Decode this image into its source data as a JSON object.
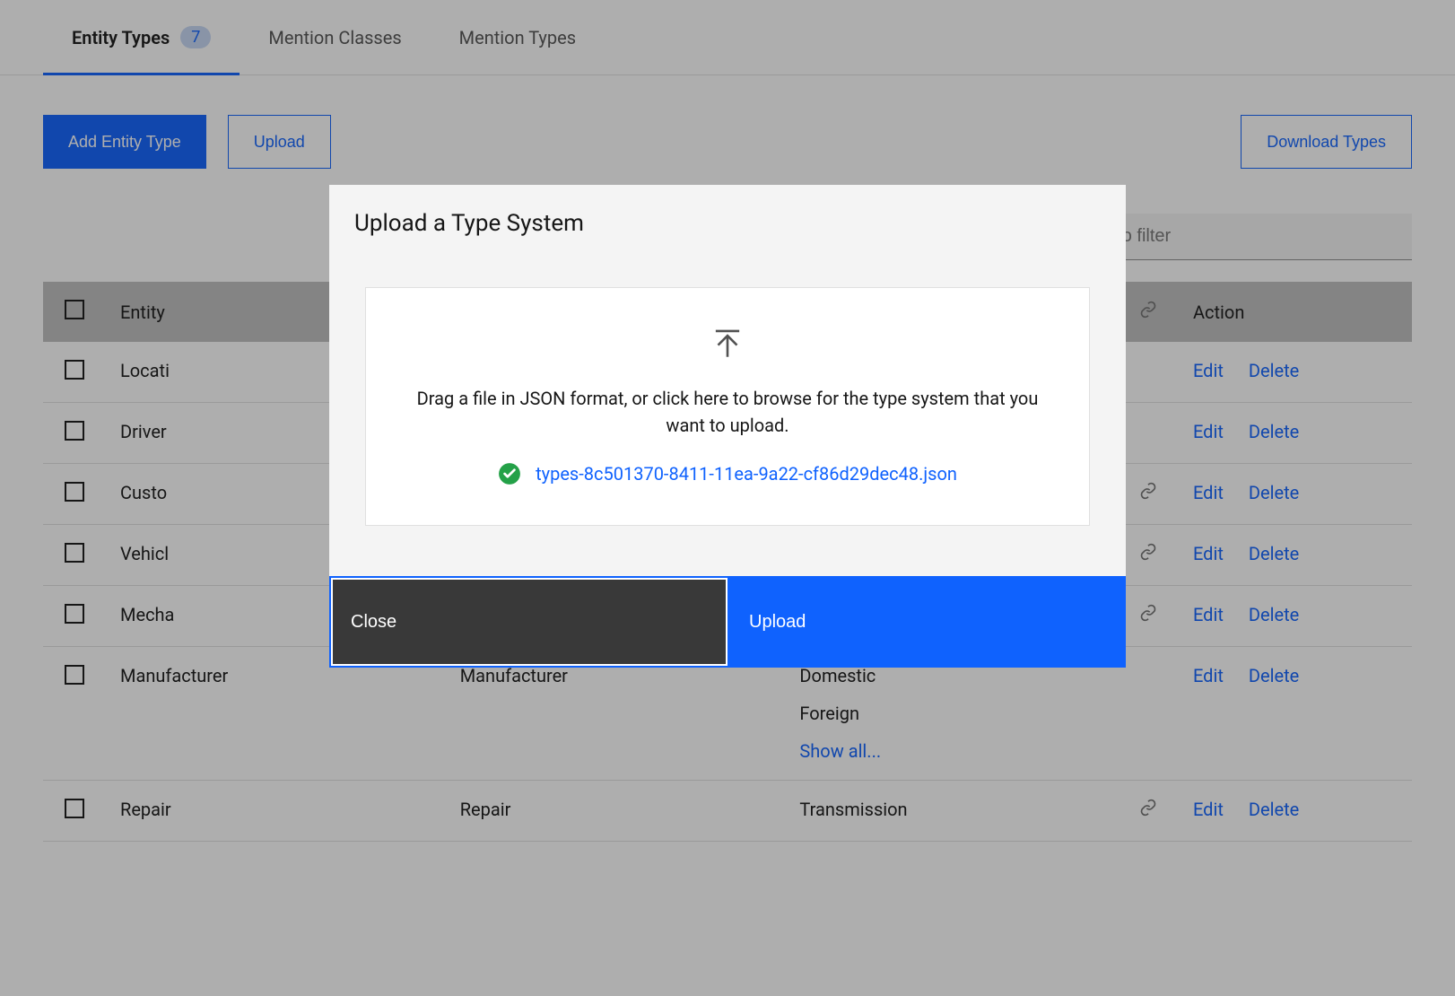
{
  "tabs": {
    "entity_types": "Entity Types",
    "entity_count": "7",
    "mention_classes": "Mention Classes",
    "mention_types": "Mention Types"
  },
  "toolbar": {
    "add": "Add Entity Type",
    "upload": "Upload",
    "download": "Download Types"
  },
  "search": {
    "placeholder": "Enter text to filter"
  },
  "table": {
    "headers": {
      "entity": "Entity",
      "action": "Action"
    },
    "edit": "Edit",
    "delete": "Delete",
    "showall": "Show all...",
    "rows": [
      {
        "entity": "Locati",
        "link": false
      },
      {
        "entity": "Driver",
        "link": false
      },
      {
        "entity": "Custo",
        "link": true
      },
      {
        "entity": "Vehicl",
        "link": true
      },
      {
        "entity": "Mecha",
        "link": true
      }
    ],
    "lower_rows": [
      {
        "entity": "Manufacturer",
        "col2": "Manufacturer",
        "sub": [
          "Domestic",
          "Foreign"
        ],
        "showall": true,
        "link": false
      },
      {
        "entity": "Repair",
        "col2": "Repair",
        "sub": [
          "Transmission"
        ],
        "showall": false,
        "link": true
      }
    ]
  },
  "modal": {
    "title": "Upload a Type System",
    "drop_text": "Drag a file in JSON format, or click here to browse for the type system that you want to upload.",
    "file": "types-8c501370-8411-11ea-9a22-cf86d29dec48.json",
    "close": "Close",
    "upload": "Upload"
  }
}
